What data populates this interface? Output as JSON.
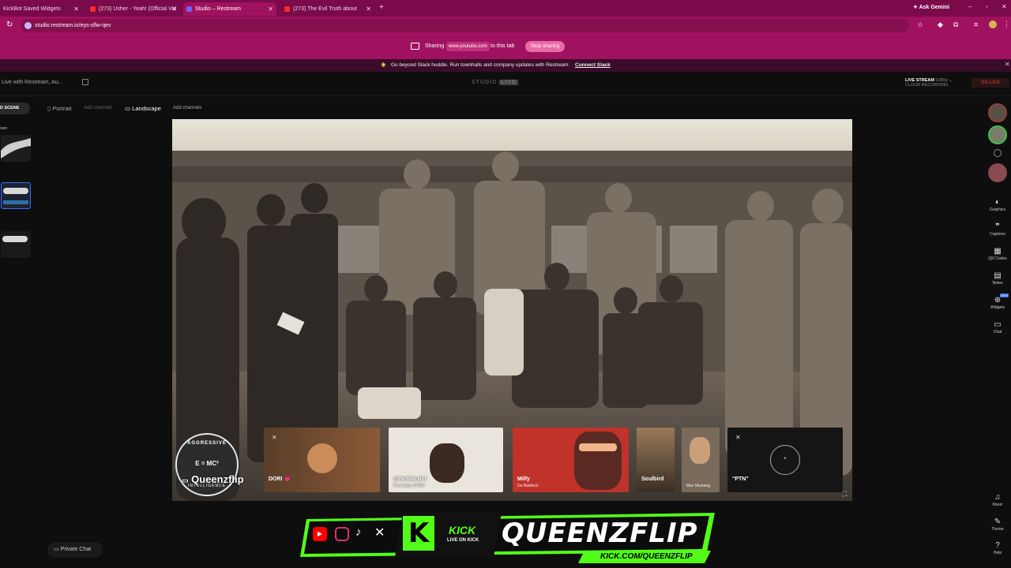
{
  "browser": {
    "tabs": [
      {
        "title": "KickBot Saved Widgets",
        "active": false,
        "color": "#3a3a3a"
      },
      {
        "title": "(273) Usher - Yeah! (Official Vid",
        "active": false,
        "color": "#ff0000"
      },
      {
        "title": "Studio – Restream",
        "active": true,
        "color": "#6b4cff"
      },
      {
        "title": "(273) The Evil Truth about",
        "active": false,
        "color": "#ff0000"
      }
    ],
    "url": "studio.restream.io/eys-sflw-qev",
    "ask_gemini": "Ask Gemini"
  },
  "sharing": {
    "label": "Sharing",
    "domain": "www.youtube.com",
    "suffix": "to this tab",
    "stop_button": "Stop sharing"
  },
  "slack_banner": {
    "text": "Go beyond Slack huddle. Run townhalls and company updates with Restream.",
    "link": "Connect Slack"
  },
  "studio": {
    "stream_title": "Live with Restream, Au...",
    "logo": "STUDIO",
    "logo_badge": "LIVE",
    "live_stream_label": "LIVE STREAM",
    "resolution": "1080p",
    "cloud_recording": "CLOUD RECORDING",
    "go_live": "GO LIVE",
    "left_heading": "D SCENE",
    "left_subheading": "own",
    "layouts": {
      "portrait": "Portrait",
      "portrait_add": "Add channels",
      "landscape": "Landscape",
      "landscape_add": "Add channels"
    },
    "private_chat": "Private Chat"
  },
  "rail": [
    {
      "label": "Graphics",
      "icon": "palette-icon"
    },
    {
      "label": "Captions",
      "icon": "captions-icon"
    },
    {
      "label": "QR Codes",
      "icon": "qr-icon"
    },
    {
      "label": "Notes",
      "icon": "notes-icon"
    },
    {
      "label": "Widgets",
      "icon": "widgets-icon",
      "badge": "NEW"
    },
    {
      "label": "Chat",
      "icon": "chat-icon"
    },
    {
      "label": "Music",
      "icon": "music-icon"
    },
    {
      "label": "Theme",
      "icon": "theme-icon"
    },
    {
      "label": "Help",
      "icon": "help-icon"
    }
  ],
  "stage": {
    "host_name": "Queenzflip",
    "logo_text": "AGGRESSIVE",
    "logo_sub": "E = MC²",
    "logo_sub2": "INTELLIGENCE",
    "guests": [
      {
        "name": "DORI 💗",
        "subtitle": "",
        "color": "#6a4a30"
      },
      {
        "name": "@nicflairalet",
        "subtitle": "First Lady of FDN",
        "color": "#e9e4dc"
      },
      {
        "name": "Milfy",
        "subtitle": "Da Baddest",
        "color": "#c0322a"
      },
      {
        "name": "Soulbird",
        "subtitle": "",
        "color": "#5a4a3a"
      },
      {
        "name": "",
        "subtitle": "Mac Mustang",
        "color": "#7a6a5a"
      },
      {
        "name": "\"PTN\"",
        "subtitle": "",
        "color": "#151515"
      }
    ]
  },
  "kick_banner": {
    "brand": "KICK",
    "sub": "LIVE ON KICK",
    "channel": "QUEENZFLIP",
    "url": "KICK.COM/QUEENZFLIP",
    "accent": "#53fc18"
  }
}
